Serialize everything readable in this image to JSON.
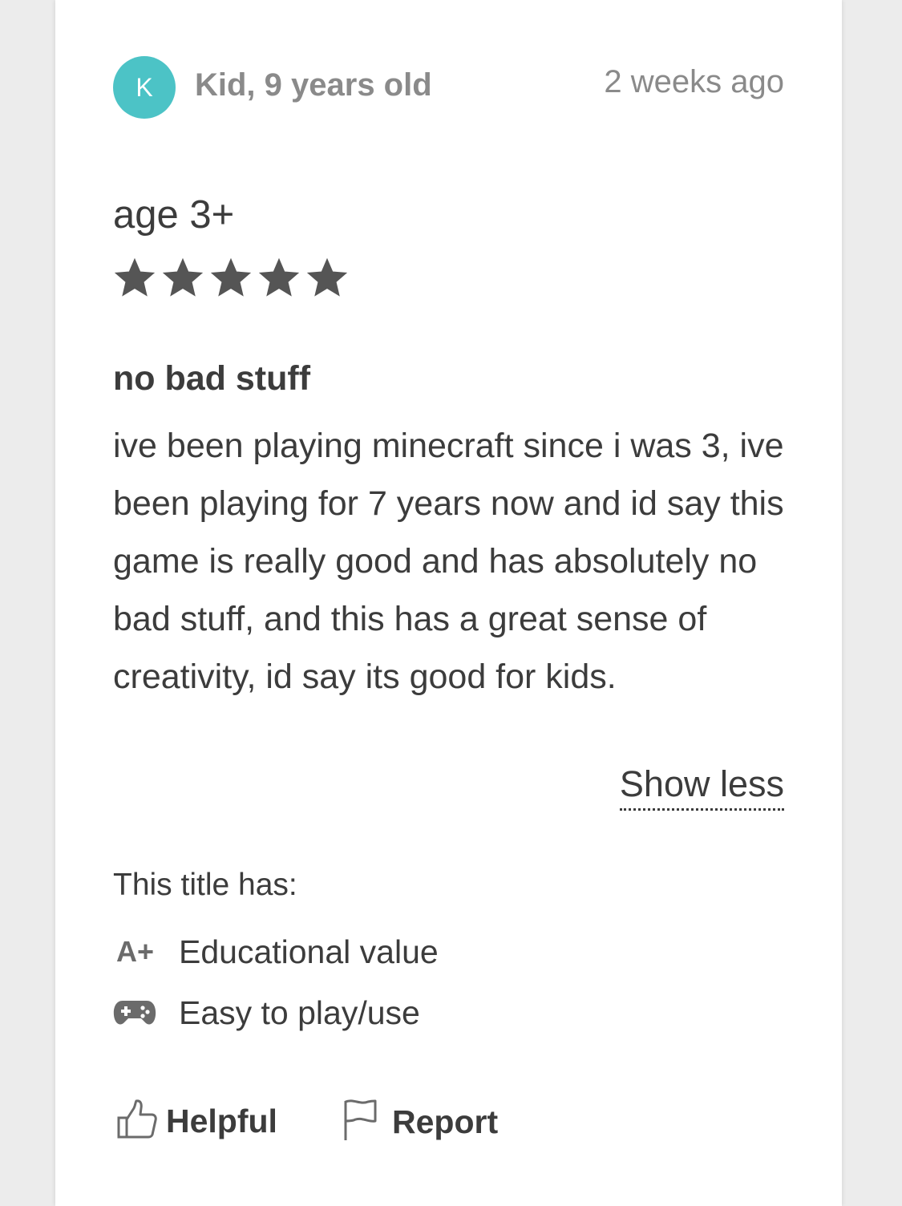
{
  "review": {
    "avatar_initial": "K",
    "reviewer": "Kid, 9 years old",
    "timestamp": "2 weeks ago",
    "age": "age 3+",
    "rating": 5,
    "rating_max": 5,
    "headline": "no bad stuff",
    "body": "ive been playing minecraft since i was 3, ive been playing for 7 years now and id say this game is really good and has absolutely no bad stuff, and this has a great sense of creativity, id say its good for kids.",
    "show_less": "Show less"
  },
  "attributes": {
    "heading": "This title has:",
    "items": [
      {
        "icon": "a-plus-icon",
        "icon_text": "A+",
        "label": "Educational value"
      },
      {
        "icon": "gamepad-icon",
        "label": "Easy to play/use"
      }
    ]
  },
  "actions": {
    "helpful": "Helpful",
    "report": "Report"
  },
  "colors": {
    "avatar": "#4cc3c6",
    "star": "#555555",
    "text": "#3c3c3c",
    "muted": "#8a8a8a",
    "background": "#ececec"
  }
}
